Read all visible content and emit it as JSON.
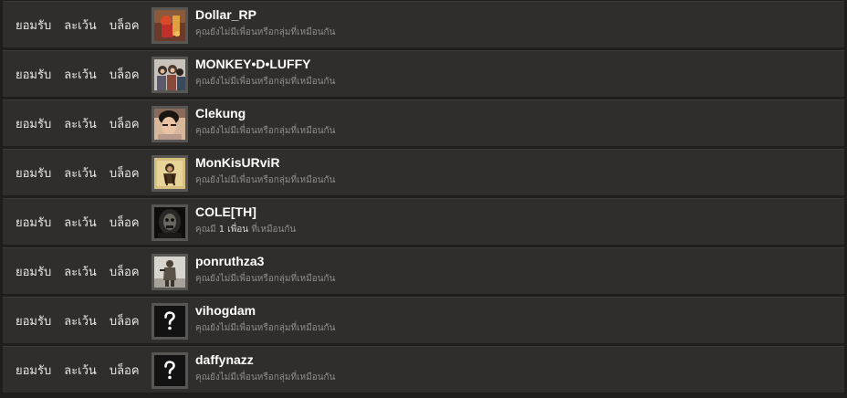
{
  "actions": {
    "accept": "ยอมรับ",
    "ignore": "ละเว้น",
    "block": "บล็อค"
  },
  "colors": {
    "row_bg": "#2f2e2c",
    "page_bg": "#1f1e1c",
    "name": "#ffffff",
    "status": "#8e8d8a"
  },
  "requests": [
    {
      "name": "Dollar_RP",
      "status": "คุณยังไม่มีเพื่อนหรือกลุ่มที่เหมือนกัน",
      "avatar": "character-red-art"
    },
    {
      "name": "MONKEY•D•LUFFY",
      "status": "คุณยังไม่มีเพื่อนหรือกลุ่มที่เหมือนกัน",
      "avatar": "group-photo"
    },
    {
      "name": "Clekung",
      "status": "คุณยังไม่มีเพื่อนหรือกลุ่มที่เหมือนกัน",
      "avatar": "person-photo"
    },
    {
      "name": "MonKisURviR",
      "status": "คุณยังไม่มีเพื่อนหรือกลุ่มที่เหมือนกัน",
      "avatar": "monkey-logo"
    },
    {
      "name": "COLE[TH]",
      "status_prefix": "คุณมี",
      "status_count": "1 เพื่อน",
      "status_suffix": "ที่เหมือนกัน",
      "avatar": "grim-reaper"
    },
    {
      "name": "ponruthza3",
      "status": "คุณยังไม่มีเพื่อนหรือกลุ่มที่เหมือนกัน",
      "avatar": "soldier"
    },
    {
      "name": "vihogdam",
      "status": "คุณยังไม่มีเพื่อนหรือกลุ่มที่เหมือนกัน",
      "avatar": "question-mark"
    },
    {
      "name": "daffynazz",
      "status": "คุณยังไม่มีเพื่อนหรือกลุ่มที่เหมือนกัน",
      "avatar": "question-mark"
    }
  ]
}
